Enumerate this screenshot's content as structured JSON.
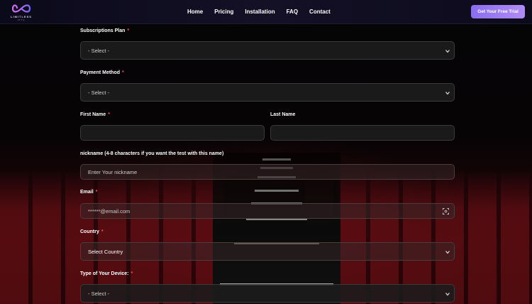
{
  "header": {
    "logo_text": "LIMITLESS",
    "logo_sub": "IPTV",
    "nav": [
      "Home",
      "Pricing",
      "Installation",
      "FAQ",
      "Contact"
    ],
    "cta": "Get Your Free Trial"
  },
  "form": {
    "subscription_label": "Subscriptions Plan",
    "subscription_value": "- Select -",
    "payment_label": "Payment Method",
    "payment_value": "- Select -",
    "first_name_label": "First Name",
    "last_name_label": "Last Name",
    "first_name_value": "",
    "last_name_value": "",
    "nickname_label": "nickname (4-8 characters if you want the test with this name)",
    "nickname_placeholder": "Enter Your nickname",
    "email_label": "Email",
    "email_placeholder": "******@email.com",
    "country_label": "Country",
    "country_value": "Select Country",
    "device_label": "Type of Your Device:",
    "device_value": "- Select -",
    "required_mark": "*"
  },
  "colors": {
    "accent": "#8a6cf0",
    "required": "#ff4d5a"
  }
}
